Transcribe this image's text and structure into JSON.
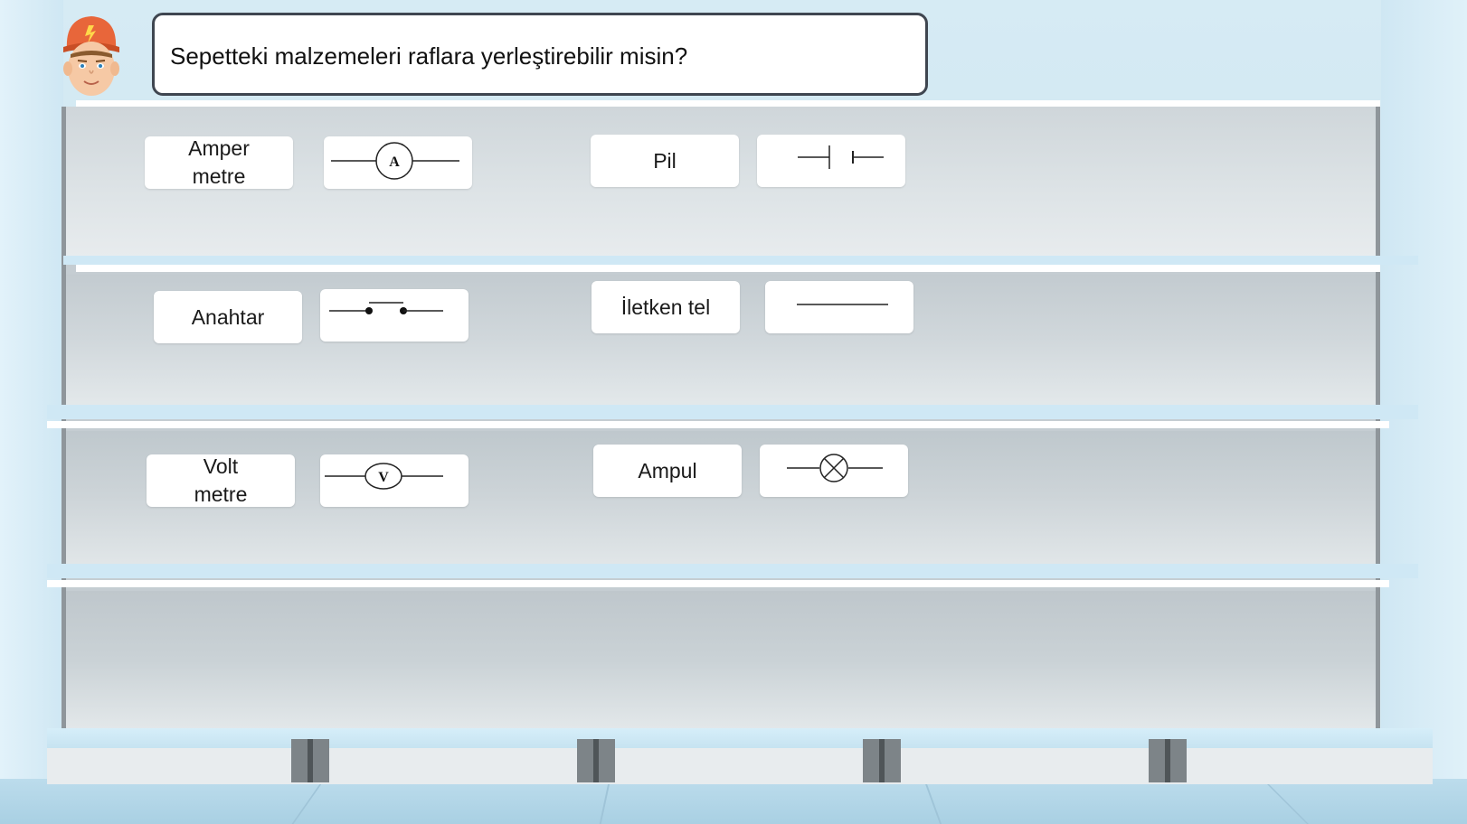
{
  "prompt": {
    "text": "Sepetteki malzemeleri raflara yerleştirebilir misin?"
  },
  "shelves": [
    {
      "items": [
        {
          "label": "Amper\nmetre",
          "symbol": "ammeter-symbol",
          "symbol_letter": "A"
        },
        {
          "label": "Pil",
          "symbol": "battery-symbol"
        }
      ]
    },
    {
      "items": [
        {
          "label": "Anahtar",
          "symbol": "switch-symbol"
        },
        {
          "label": "İletken tel",
          "symbol": "wire-symbol"
        }
      ]
    },
    {
      "items": [
        {
          "label": "Volt\nmetre",
          "symbol": "voltmeter-symbol",
          "symbol_letter": "V"
        },
        {
          "label": "Ampul",
          "symbol": "lamp-symbol"
        }
      ]
    }
  ],
  "colors": {
    "speech_border": "#3f4650",
    "shelf_lip": "#cfe8f5",
    "cap": "#e8663a"
  }
}
